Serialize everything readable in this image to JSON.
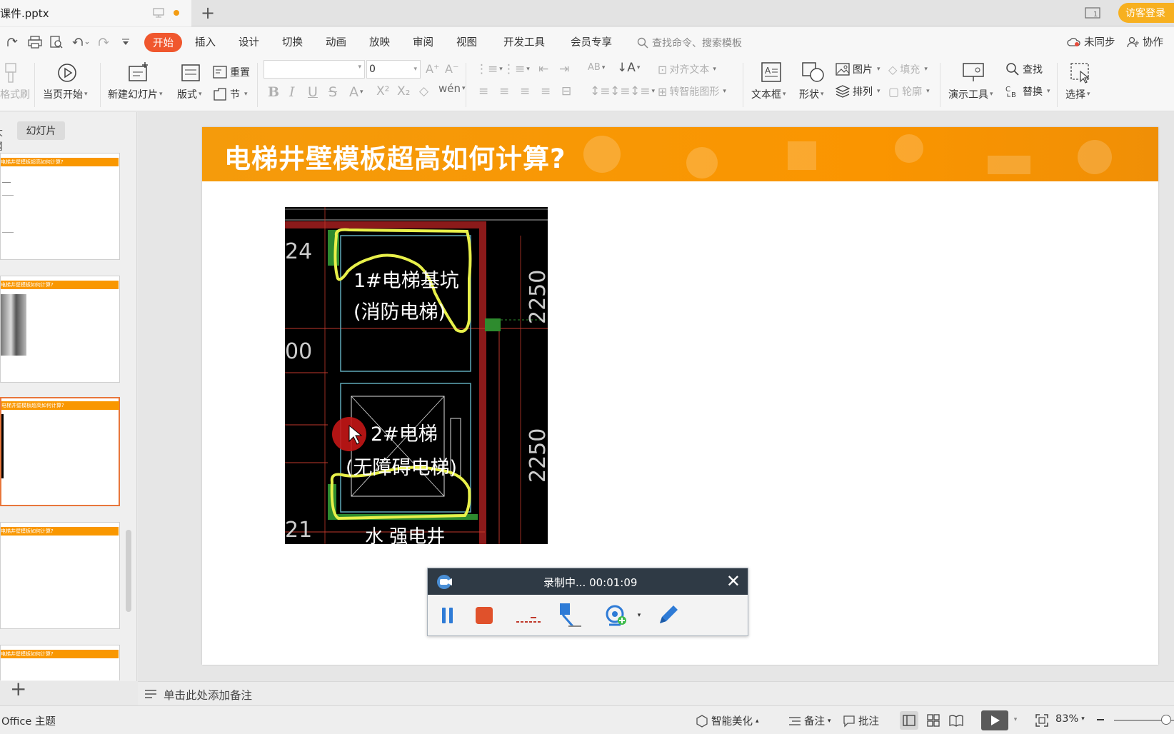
{
  "titlebar": {
    "doc_name": "课件.pptx",
    "login_label": "访客登录"
  },
  "menu": {
    "active_tab": "开始",
    "tabs": [
      "插入",
      "设计",
      "切换",
      "动画",
      "放映",
      "审阅",
      "视图",
      "开发工具",
      "会员专享"
    ],
    "search_placeholder": "查找命令、搜索模板",
    "sync_label": "未同步",
    "collab_label": "协作"
  },
  "ribbon": {
    "format_brush": "格式刷",
    "play_from_current": "当页开始",
    "new_slide": "新建幻灯片",
    "layout": "版式",
    "reset": "重置",
    "section": "节",
    "font_size": "0",
    "align_text": "对齐文本",
    "smart_art": "转智能图形",
    "textbox": "文本框",
    "shape": "形状",
    "picture": "图片",
    "arrange": "排列",
    "fill": "填充",
    "outline": "轮廓",
    "present_tools": "演示工具",
    "find": "查找",
    "replace": "替换",
    "select": "选择"
  },
  "leftpanel": {
    "outline_tab": "大纲",
    "slides_tab": "幻灯片",
    "thumb_titles": [
      "电梯井壁模板超高如何计算?",
      "电梯井壁模板如何计算?",
      "电梯井壁模板超高如何计算?",
      "电梯井壁模板如何计算?",
      "电梯井壁模板如何计算?"
    ]
  },
  "slide": {
    "title": "电梯井壁模板超高如何计算?",
    "cad_labels": {
      "elevator1_line1": "1#电梯基坑",
      "elevator1_line2": "(消防电梯)",
      "elevator2_line1": "2#电梯",
      "elevator2_line2": "(无障碍电梯)",
      "dim1": "2250",
      "dim2": "2250",
      "num_24": "24",
      "num_00": "00",
      "num_21": "21",
      "bottom_text": "水  强电井"
    }
  },
  "recorder": {
    "status": "录制中... 00:01:09"
  },
  "notes": {
    "placeholder": "单击此处添加备注"
  },
  "statusbar": {
    "theme": "Office 主题",
    "beautify": "智能美化",
    "notes": "备注",
    "comments": "批注",
    "zoom": "83%"
  }
}
